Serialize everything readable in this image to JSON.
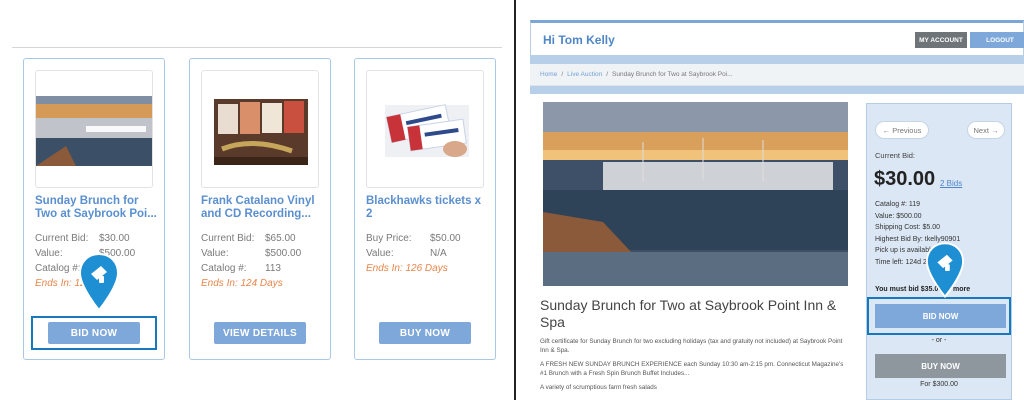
{
  "left": {
    "cards": [
      {
        "title": "Sunday Brunch for Two at Saybrook Poi...",
        "rows": [
          {
            "k": "Current Bid:",
            "v": "$30.00"
          },
          {
            "k": "Value:",
            "v": "$500.00"
          },
          {
            "k": "Catalog #:",
            "v": "119"
          }
        ],
        "ends": "Ends In: 124 Days",
        "button": "BID NOW"
      },
      {
        "title": "Frank Catalano Vinyl and CD Recording...",
        "rows": [
          {
            "k": "Current Bid:",
            "v": "$65.00"
          },
          {
            "k": "Value:",
            "v": "$500.00"
          },
          {
            "k": "Catalog #:",
            "v": "113"
          }
        ],
        "ends": "Ends In: 124 Days",
        "button": "VIEW DETAILS"
      },
      {
        "title": "Blackhawks tickets x 2",
        "rows": [
          {
            "k": "Buy Price:",
            "v": "$50.00"
          },
          {
            "k": "Value:",
            "v": "N/A"
          }
        ],
        "ends": "Ends In: 126 Days",
        "button": "BUY NOW"
      }
    ]
  },
  "right": {
    "greeting": "Hi Tom Kelly",
    "my_account": "MY ACCOUNT",
    "logout": "LOGOUT",
    "breadcrumb": {
      "home": "Home",
      "sep": "/",
      "live": "Live Auction",
      "current": "Sunday Brunch for Two at Saybrook Poi..."
    },
    "item_title": "Sunday Brunch for Two at Saybrook Point Inn & Spa",
    "desc1": "Gift certificate for Sunday Brunch for two excluding holidays (tax and gratuity not included) at Saybrook Point Inn & Spa.",
    "desc2": "A FRESH NEW SUNDAY BRUNCH EXPERIENCE each Sunday 10:30 am-2:15 pm. Connecticut Magazine's #1 Brunch with a Fresh Spin Brunch Buffet Includes...",
    "desc3": "A variety of scrumptious farm fresh salads",
    "prev": "← Previous",
    "next": "Next →",
    "current_bid_label": "Current Bid:",
    "current_bid": "$30.00",
    "bids_link": "2 Bids",
    "info": [
      "Catalog #: 119",
      "Value: $500.00",
      "Shipping Cost: $5.00",
      "Highest Bid By: tkelly90901",
      "Pick up is available",
      "Time left: 124d 22h 30m 28s"
    ],
    "must_bid": "You must bid $35.00 or more",
    "bid_now": "BID NOW",
    "or": "- or -",
    "buy_now": "BUY NOW",
    "buy_price": "For $300.00"
  },
  "colors": {
    "accent": "#7fa8da",
    "link": "#5a8fd0",
    "highlight": "#1779bb",
    "ends": "#e8864a"
  }
}
